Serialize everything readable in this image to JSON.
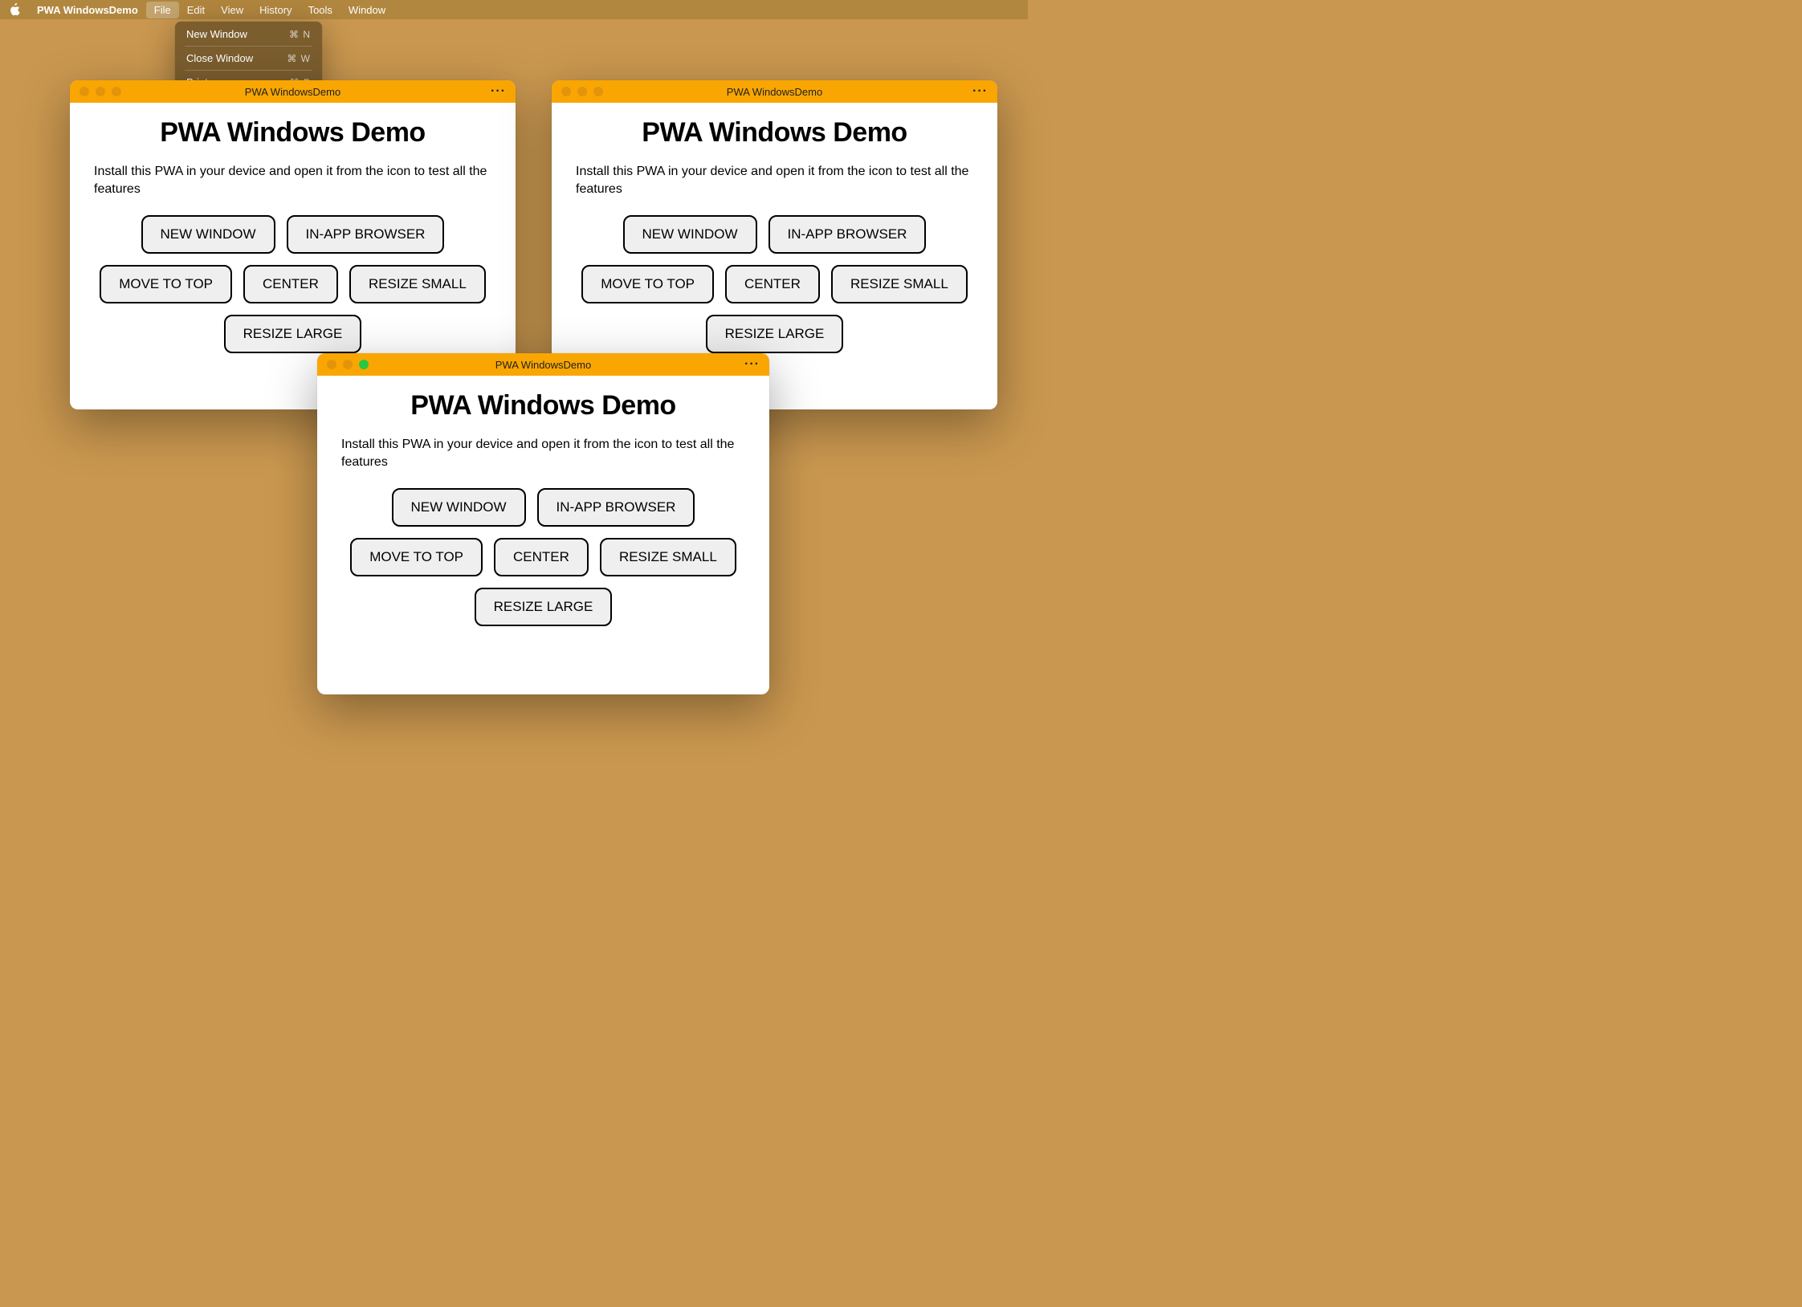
{
  "menubar": {
    "app_name": "PWA WindowsDemo",
    "items": [
      "File",
      "Edit",
      "View",
      "History",
      "Tools",
      "Window"
    ],
    "active_item": "File"
  },
  "dropdown": {
    "items": [
      {
        "label": "New Window",
        "shortcut": "⌘ N"
      },
      {
        "label": "Close Window",
        "shortcut": "⌘ W"
      },
      {
        "label": "Print…",
        "shortcut": "⌘ P"
      }
    ]
  },
  "window": {
    "title": "PWA WindowsDemo",
    "more": "···",
    "content_title": "PWA Windows Demo",
    "content_desc": "Install this PWA in your device and open it from the icon to test all the features",
    "buttons": [
      "NEW WINDOW",
      "IN-APP BROWSER",
      "MOVE TO TOP",
      "CENTER",
      "RESIZE SMALL",
      "RESIZE LARGE"
    ]
  }
}
